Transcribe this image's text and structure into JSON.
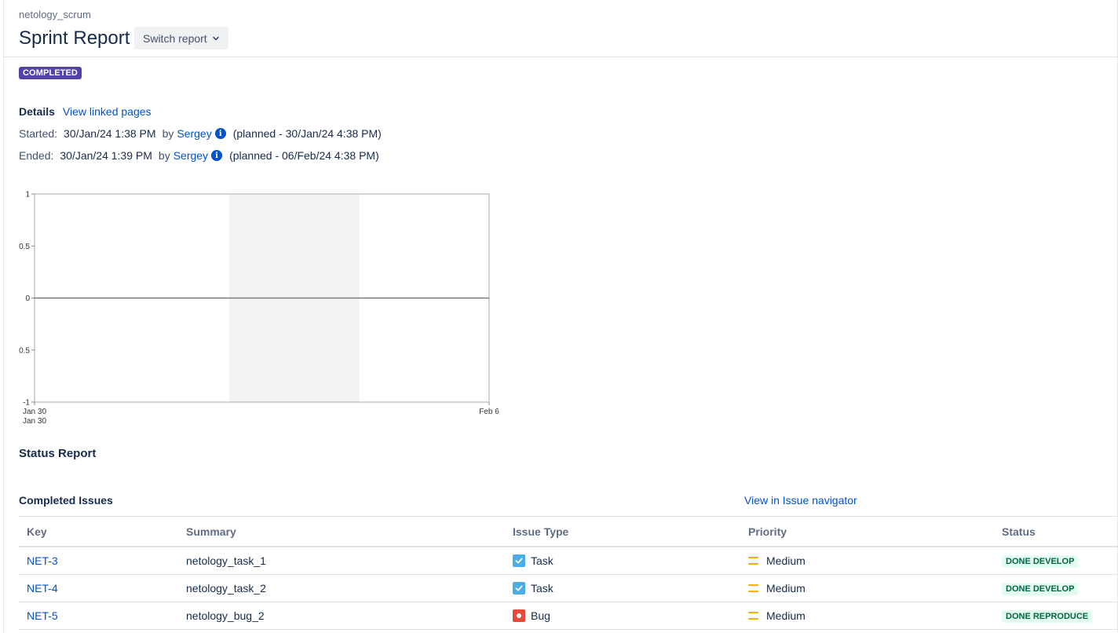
{
  "header": {
    "project": "netology_scrum",
    "title": "Sprint Report",
    "switch_label": "Switch report"
  },
  "sprint_status": "COMPLETED",
  "details": {
    "label": "Details",
    "linked_pages": "View linked pages",
    "started": {
      "label": "Started:",
      "date": "30/Jan/24 1:38 PM",
      "by": "by",
      "user": "Sergey",
      "planned": "(planned - 30/Jan/24 4:38 PM)"
    },
    "ended": {
      "label": "Ended:",
      "date": "30/Jan/24 1:39 PM",
      "by": "by",
      "user": "Sergey",
      "planned": "(planned - 06/Feb/24 4:38 PM)"
    }
  },
  "chart_data": {
    "type": "line",
    "title": "",
    "xlabel": "",
    "ylabel": "",
    "y_ticks": [
      "1",
      "0.5",
      "0",
      "0.5",
      "-1"
    ],
    "ylim": [
      -1,
      1
    ],
    "x_ticks": [
      "Jan 30",
      "Feb 6"
    ],
    "x_sub_tick": "Jan 30",
    "xlim": [
      "Jan 30",
      "Feb 6"
    ],
    "shaded_range": [
      "Feb 2",
      "Feb 4"
    ],
    "series": [
      {
        "x": [
          "Jan 30",
          "Feb 6"
        ],
        "values": [
          0,
          0
        ]
      }
    ],
    "grid": false,
    "colors": {
      "line": "#7a7a7a",
      "shade": "#f2f2f2",
      "frame": "#aaaaaa"
    }
  },
  "status_report": {
    "title": "Status Report",
    "completed_title": "Completed Issues",
    "navigator_link": "View in Issue navigator",
    "columns": [
      "Key",
      "Summary",
      "Issue Type",
      "Priority",
      "Status"
    ],
    "rows": [
      {
        "key": "NET-3",
        "summary": "netology_task_1",
        "type": "Task",
        "type_icon": "task-checkbox-icon",
        "priority": "Medium",
        "status": "DONE DEVELOP"
      },
      {
        "key": "NET-4",
        "summary": "netology_task_2",
        "type": "Task",
        "type_icon": "task-checkbox-icon",
        "priority": "Medium",
        "status": "DONE DEVELOP"
      },
      {
        "key": "NET-5",
        "summary": "netology_bug_2",
        "type": "Bug",
        "type_icon": "bug-icon",
        "priority": "Medium",
        "status": "DONE REPRODUCE"
      }
    ]
  }
}
